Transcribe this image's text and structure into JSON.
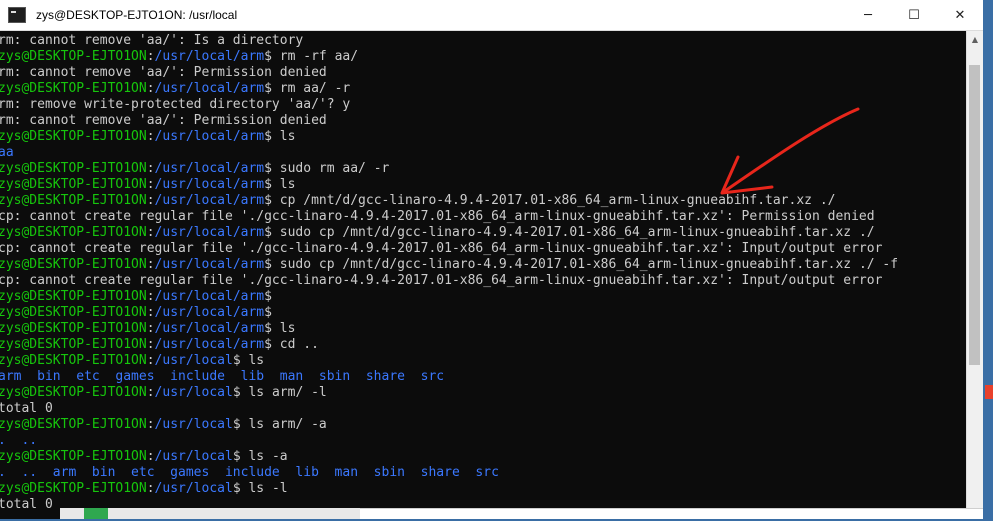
{
  "window": {
    "title": "zys@DESKTOP-EJTO1ON: /usr/local",
    "minimize_glyph": "─",
    "maximize_glyph": "☐",
    "close_glyph": "✕"
  },
  "terminal": {
    "lines": [
      [
        {
          "t": "rm: cannot remove 'aa/': Is a directory",
          "c": "w"
        }
      ],
      [
        {
          "t": "zys@DESKTOP-EJTO1ON",
          "c": "g"
        },
        {
          "t": ":",
          "c": "w"
        },
        {
          "t": "/usr/local/arm",
          "c": "b"
        },
        {
          "t": "$ rm -rf aa/",
          "c": "w"
        }
      ],
      [
        {
          "t": "rm: cannot remove 'aa/': Permission denied",
          "c": "w"
        }
      ],
      [
        {
          "t": "zys@DESKTOP-EJTO1ON",
          "c": "g"
        },
        {
          "t": ":",
          "c": "w"
        },
        {
          "t": "/usr/local/arm",
          "c": "b"
        },
        {
          "t": "$ rm aa/ -r",
          "c": "w"
        }
      ],
      [
        {
          "t": "rm: remove write-protected directory 'aa/'? y",
          "c": "w"
        }
      ],
      [
        {
          "t": "rm: cannot remove 'aa/': Permission denied",
          "c": "w"
        }
      ],
      [
        {
          "t": "zys@DESKTOP-EJTO1ON",
          "c": "g"
        },
        {
          "t": ":",
          "c": "w"
        },
        {
          "t": "/usr/local/arm",
          "c": "b"
        },
        {
          "t": "$ ls",
          "c": "w"
        }
      ],
      [
        {
          "t": "aa",
          "c": "b"
        }
      ],
      [
        {
          "t": "zys@DESKTOP-EJTO1ON",
          "c": "g"
        },
        {
          "t": ":",
          "c": "w"
        },
        {
          "t": "/usr/local/arm",
          "c": "b"
        },
        {
          "t": "$ sudo rm aa/ -r",
          "c": "w"
        }
      ],
      [
        {
          "t": "zys@DESKTOP-EJTO1ON",
          "c": "g"
        },
        {
          "t": ":",
          "c": "w"
        },
        {
          "t": "/usr/local/arm",
          "c": "b"
        },
        {
          "t": "$ ls",
          "c": "w"
        }
      ],
      [
        {
          "t": "zys@DESKTOP-EJTO1ON",
          "c": "g"
        },
        {
          "t": ":",
          "c": "w"
        },
        {
          "t": "/usr/local/arm",
          "c": "b"
        },
        {
          "t": "$ cp /mnt/d/gcc-linaro-4.9.4-2017.01-x86_64_arm-linux-gnueabihf.tar.xz ./",
          "c": "w"
        }
      ],
      [
        {
          "t": "cp: cannot create regular file './gcc-linaro-4.9.4-2017.01-x86_64_arm-linux-gnueabihf.tar.xz': Permission denied",
          "c": "w"
        }
      ],
      [
        {
          "t": "zys@DESKTOP-EJTO1ON",
          "c": "g"
        },
        {
          "t": ":",
          "c": "w"
        },
        {
          "t": "/usr/local/arm",
          "c": "b"
        },
        {
          "t": "$ sudo cp /mnt/d/gcc-linaro-4.9.4-2017.01-x86_64_arm-linux-gnueabihf.tar.xz ./",
          "c": "w"
        }
      ],
      [
        {
          "t": "cp: cannot create regular file './gcc-linaro-4.9.4-2017.01-x86_64_arm-linux-gnueabihf.tar.xz': Input/output error",
          "c": "w"
        }
      ],
      [
        {
          "t": "zys@DESKTOP-EJTO1ON",
          "c": "g"
        },
        {
          "t": ":",
          "c": "w"
        },
        {
          "t": "/usr/local/arm",
          "c": "b"
        },
        {
          "t": "$ sudo cp /mnt/d/gcc-linaro-4.9.4-2017.01-x86_64_arm-linux-gnueabihf.tar.xz ./ -f",
          "c": "w"
        }
      ],
      [
        {
          "t": "cp: cannot create regular file './gcc-linaro-4.9.4-2017.01-x86_64_arm-linux-gnueabihf.tar.xz': Input/output error",
          "c": "w"
        }
      ],
      [
        {
          "t": "zys@DESKTOP-EJTO1ON",
          "c": "g"
        },
        {
          "t": ":",
          "c": "w"
        },
        {
          "t": "/usr/local/arm",
          "c": "b"
        },
        {
          "t": "$",
          "c": "w"
        }
      ],
      [
        {
          "t": "zys@DESKTOP-EJTO1ON",
          "c": "g"
        },
        {
          "t": ":",
          "c": "w"
        },
        {
          "t": "/usr/local/arm",
          "c": "b"
        },
        {
          "t": "$",
          "c": "w"
        }
      ],
      [
        {
          "t": "zys@DESKTOP-EJTO1ON",
          "c": "g"
        },
        {
          "t": ":",
          "c": "w"
        },
        {
          "t": "/usr/local/arm",
          "c": "b"
        },
        {
          "t": "$ ls",
          "c": "w"
        }
      ],
      [
        {
          "t": "zys@DESKTOP-EJTO1ON",
          "c": "g"
        },
        {
          "t": ":",
          "c": "w"
        },
        {
          "t": "/usr/local/arm",
          "c": "b"
        },
        {
          "t": "$ cd ..",
          "c": "w"
        }
      ],
      [
        {
          "t": "zys@DESKTOP-EJTO1ON",
          "c": "g"
        },
        {
          "t": ":",
          "c": "w"
        },
        {
          "t": "/usr/local",
          "c": "b"
        },
        {
          "t": "$ ls",
          "c": "w"
        }
      ],
      [
        {
          "t": "arm  bin  etc  games  include  lib  man  sbin  share  src",
          "c": "b"
        }
      ],
      [
        {
          "t": "zys@DESKTOP-EJTO1ON",
          "c": "g"
        },
        {
          "t": ":",
          "c": "w"
        },
        {
          "t": "/usr/local",
          "c": "b"
        },
        {
          "t": "$ ls arm/ -l",
          "c": "w"
        }
      ],
      [
        {
          "t": "total 0",
          "c": "w"
        }
      ],
      [
        {
          "t": "zys@DESKTOP-EJTO1ON",
          "c": "g"
        },
        {
          "t": ":",
          "c": "w"
        },
        {
          "t": "/usr/local",
          "c": "b"
        },
        {
          "t": "$ ls arm/ -a",
          "c": "w"
        }
      ],
      [
        {
          "t": ".  ..",
          "c": "b"
        }
      ],
      [
        {
          "t": "zys@DESKTOP-EJTO1ON",
          "c": "g"
        },
        {
          "t": ":",
          "c": "w"
        },
        {
          "t": "/usr/local",
          "c": "b"
        },
        {
          "t": "$ ls -a",
          "c": "w"
        }
      ],
      [
        {
          "t": ".  ..  arm  bin  etc  games  include  lib  man  sbin  share  src",
          "c": "b"
        }
      ],
      [
        {
          "t": "zys@DESKTOP-EJTO1ON",
          "c": "g"
        },
        {
          "t": ":",
          "c": "w"
        },
        {
          "t": "/usr/local",
          "c": "b"
        },
        {
          "t": "$ ls -l",
          "c": "w"
        }
      ],
      [
        {
          "t": "total 0",
          "c": "w"
        }
      ]
    ]
  },
  "scrollbar": {
    "up_glyph": "▲",
    "down_glyph": "▼"
  },
  "annotation": {
    "arrow_color": "#e8261b"
  },
  "colors": {
    "prompt_user": "#16c60c",
    "path": "#3b78ff",
    "text": "#cccccc",
    "background": "#0c0c0c"
  }
}
